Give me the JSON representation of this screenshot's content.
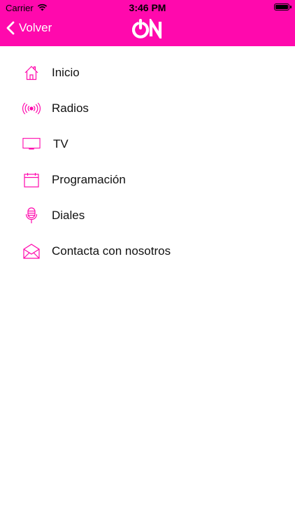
{
  "status_bar": {
    "carrier": "Carrier",
    "time": "3:46 PM",
    "icons": [
      "wifi-icon",
      "battery-icon"
    ]
  },
  "nav": {
    "back_label": "Volver",
    "back_icon": "chevron-left-icon",
    "logo_text": "ON"
  },
  "colors": {
    "brand": "#ff09ad",
    "nav_text": "#ffffff",
    "item_text": "#111111"
  },
  "menu": {
    "items": [
      {
        "label": "Inicio",
        "icon": "home-icon"
      },
      {
        "label": "Radios",
        "icon": "broadcast-icon"
      },
      {
        "label": "TV",
        "icon": "tv-icon"
      },
      {
        "label": "Programación",
        "icon": "calendar-icon"
      },
      {
        "label": "Diales",
        "icon": "microphone-icon"
      },
      {
        "label": "Contacta con nosotros",
        "icon": "envelope-icon"
      }
    ]
  }
}
